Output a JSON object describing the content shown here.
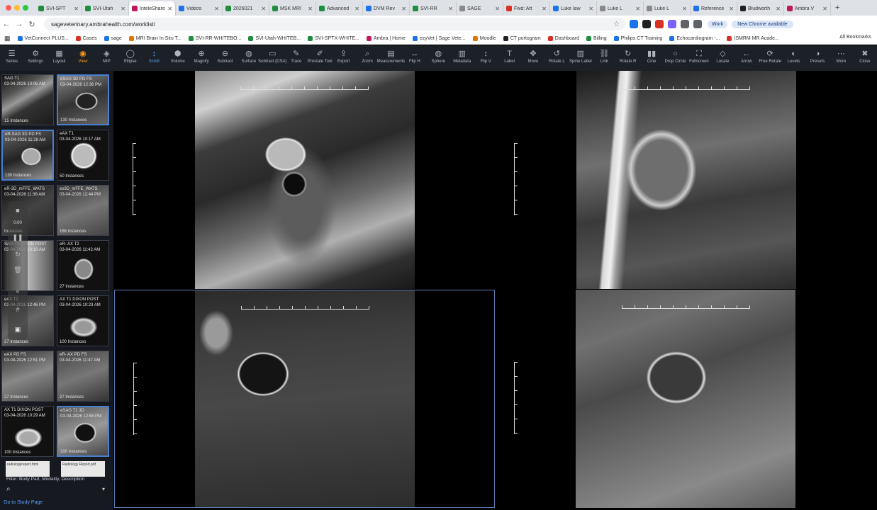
{
  "browser": {
    "tabs": [
      {
        "title": "SVI-SPT",
        "color": "#1e8e3e"
      },
      {
        "title": "SVI-Utah",
        "color": "#1e8e3e"
      },
      {
        "title": "InteleShare",
        "color": "#c2185b",
        "active": true
      },
      {
        "title": "Videos",
        "color": "#1a73e8"
      },
      {
        "title": "2026021",
        "color": "#1e8e3e"
      },
      {
        "title": "MSK MRI",
        "color": "#1e8e3e"
      },
      {
        "title": "Advanced",
        "color": "#1e8e3e"
      },
      {
        "title": "DVM Rev",
        "color": "#1a73e8"
      },
      {
        "title": "SVI-RR",
        "color": "#1e8e3e"
      },
      {
        "title": "SAGE",
        "color": "#888888"
      },
      {
        "title": "Fwd: Att",
        "color": "#d93025"
      },
      {
        "title": "Luke law",
        "color": "#1a73e8"
      },
      {
        "title": "Luke L",
        "color": "#888888"
      },
      {
        "title": "Luke L",
        "color": "#888888"
      },
      {
        "title": "Reference",
        "color": "#1a73e8"
      },
      {
        "title": "Bludworth",
        "color": "#202124"
      },
      {
        "title": "Ambra V",
        "color": "#c2185b"
      }
    ],
    "url": "sageveterinary.ambrahealth.com/worklist/",
    "profile_label": "Work",
    "update_label": "New Chrome available",
    "bookmarks": [
      {
        "label": "VetConnect PLUS...",
        "color": "#1a73e8"
      },
      {
        "label": "Cases",
        "color": "#d93025"
      },
      {
        "label": "sage",
        "color": "#1a73e8"
      },
      {
        "label": "MRI Brain In Situ T...",
        "color": "#e37400"
      },
      {
        "label": "SVI-RR-WHITEBO...",
        "color": "#1e8e3e"
      },
      {
        "label": "SVI-Utah-WHITEB...",
        "color": "#1e8e3e"
      },
      {
        "label": "SVI-SPTX-WHITE...",
        "color": "#1e8e3e"
      },
      {
        "label": "Ambra | Home",
        "color": "#c2185b"
      },
      {
        "label": "ezyVet | Sage Vete...",
        "color": "#1a73e8"
      },
      {
        "label": "Moodle",
        "color": "#e37400"
      },
      {
        "label": "CT portogram",
        "color": "#202124"
      },
      {
        "label": "Dashboard",
        "color": "#d93025"
      },
      {
        "label": "Billing",
        "color": "#1e8e3e"
      },
      {
        "label": "Philips CT Training",
        "color": "#1a73e8"
      },
      {
        "label": "Echocardiogram -...",
        "color": "#1a73e8"
      },
      {
        "label": "ISMRM MR Acade...",
        "color": "#d93025"
      }
    ],
    "all_bookmarks_label": "All Bookmarks"
  },
  "toolbar": {
    "tools": [
      {
        "label": "Series",
        "icon": "☰",
        "name": "series-tool"
      },
      {
        "label": "Settings",
        "icon": "⚙",
        "name": "settings-tool"
      },
      {
        "label": "Layout",
        "icon": "▦",
        "name": "layout-tool"
      },
      {
        "label": "View",
        "icon": "◉",
        "name": "view-tool",
        "state": "hl"
      },
      {
        "label": "MIP",
        "icon": "◈",
        "name": "mip-tool"
      },
      {
        "label": "Ellipse",
        "icon": "◯",
        "name": "ellipse-tool"
      },
      {
        "label": "Scroll",
        "icon": "↕",
        "name": "scroll-tool",
        "state": "sel"
      },
      {
        "label": "Volume",
        "icon": "⬢",
        "name": "volume-tool"
      },
      {
        "label": "Magnify",
        "icon": "⊕",
        "name": "magnify-tool"
      },
      {
        "label": "Subtract",
        "icon": "⊖",
        "name": "subtract-tool"
      },
      {
        "label": "Surface",
        "icon": "◍",
        "name": "surface-tool"
      },
      {
        "label": "Subtract (DSA)",
        "icon": "▭",
        "name": "subtract-dsa-tool"
      },
      {
        "label": "Trace",
        "icon": "✎",
        "name": "trace-tool"
      },
      {
        "label": "Prostate Tool",
        "icon": "✐",
        "name": "prostate-tool"
      },
      {
        "label": "Export",
        "icon": "⇪",
        "name": "export-tool"
      },
      {
        "label": "Zoom",
        "icon": "⌕",
        "name": "zoom-tool"
      },
      {
        "label": "Measurements",
        "icon": "▤",
        "name": "measurements-tool"
      },
      {
        "label": "Flip H",
        "icon": "↔",
        "name": "flip-h-tool"
      },
      {
        "label": "Sphere",
        "icon": "◍",
        "name": "sphere-tool"
      },
      {
        "label": "Metadata",
        "icon": "▥",
        "name": "metadata-tool"
      },
      {
        "label": "Flip V",
        "icon": "↕",
        "name": "flip-v-tool"
      },
      {
        "label": "Label",
        "icon": "T",
        "name": "label-tool"
      },
      {
        "label": "Move",
        "icon": "✥",
        "name": "move-tool"
      },
      {
        "label": "Rotate L",
        "icon": "↺",
        "name": "rotate-left-tool"
      },
      {
        "label": "Spine Label",
        "icon": "▥",
        "name": "spine-label-tool"
      },
      {
        "label": "Link",
        "icon": "⛓",
        "name": "link-tool"
      },
      {
        "label": "Rotate R",
        "icon": "↻",
        "name": "rotate-right-tool"
      },
      {
        "label": "Cine",
        "icon": "▮▮",
        "name": "cine-tool"
      },
      {
        "label": "Drop Circle",
        "icon": "○",
        "name": "drop-circle-tool"
      },
      {
        "label": "Fullscreen",
        "icon": "⛶",
        "name": "fullscreen-tool"
      },
      {
        "label": "Locate",
        "icon": "◇",
        "name": "locate-tool"
      },
      {
        "label": "Arrow",
        "icon": "←",
        "name": "arrow-tool"
      },
      {
        "label": "Free Rotate",
        "icon": "⟳",
        "name": "free-rotate-tool"
      },
      {
        "label": "Levels",
        "icon": "◐",
        "name": "levels-tool"
      },
      {
        "label": "Presets",
        "icon": "◑",
        "name": "presets-tool"
      },
      {
        "label": "More",
        "icon": "⋯",
        "name": "more-tool"
      },
      {
        "label": "Close",
        "icon": "✖",
        "name": "close-tool"
      }
    ]
  },
  "sidebar": {
    "series": [
      {
        "name": "SAG T1",
        "date": "03-04-2026 10:06 AM",
        "count": "15 Instances"
      },
      {
        "name": "eSAG 3D PD FS",
        "date": "03-04-2026 12:36 PM",
        "count": "130 Instances",
        "active": true
      },
      {
        "name": "eR-SAG 3D PD FS",
        "date": "03-04-2026 11:28 AM",
        "count": "130 Instances",
        "active": true
      },
      {
        "name": "eAX T1",
        "date": "03-04-2026 10:17 AM",
        "count": "50 Instances"
      },
      {
        "name": "eR-3D_mFFE_WATS",
        "date": "03-04-2026 11:36 AM",
        "count": "Instances"
      },
      {
        "name": "es3D_mFFE_WATS",
        "date": "03-04-2026 12:44 PM",
        "count": "168 Instances"
      },
      {
        "name": "SAG T1 DIXON POST",
        "date": "03-04-2026 10:18 AM",
        "count": ""
      },
      {
        "name": "eR- AX T2",
        "date": "03-04-2026 11:42 AM",
        "count": "27 Instances"
      },
      {
        "name": "eAX T2",
        "date": "03-04-2026 12:46 PM",
        "count": "27 Instances"
      },
      {
        "name": "AX T1 DIXON POST",
        "date": "03-04-2026 10:23 AM",
        "count": "100 Instances"
      },
      {
        "name": "eAX PD FS",
        "date": "03-04-2026 12:51 PM",
        "count": "27 Instances"
      },
      {
        "name": "eR- AX PD FS",
        "date": "03-04-2026 11:47 AM",
        "count": "27 Instances"
      },
      {
        "name": "AX T1 DIXON POST",
        "date": "03-04-2026 10:29 AM",
        "count": "100 Instances"
      },
      {
        "name": "eSAG T2 3D",
        "date": "03-04-2026 12:58 PM",
        "count": "100 Instances",
        "active": true
      }
    ],
    "reports": [
      "radiologyreport.html",
      "Radiology Report.pdf"
    ],
    "filter_label": "Filter: Body Part, Modality, Description",
    "goto_study": "Go to Study Page"
  },
  "video_overlay": {
    "time": "0:00"
  }
}
